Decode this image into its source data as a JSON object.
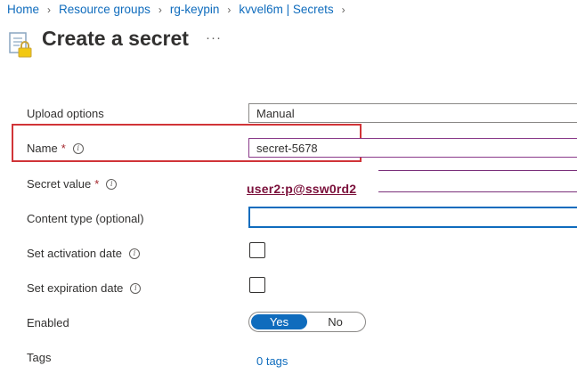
{
  "breadcrumb": [
    {
      "label": "Home"
    },
    {
      "label": "Resource groups"
    },
    {
      "label": "rg-keypin"
    },
    {
      "label": "kvvel6m | Secrets"
    }
  ],
  "header": {
    "title": "Create a secret",
    "more": "···"
  },
  "form": {
    "upload_options": {
      "label": "Upload options",
      "value": "Manual"
    },
    "name": {
      "label": "Name",
      "required": "*",
      "value": "secret-5678"
    },
    "secret_value": {
      "label": "Secret value",
      "required": "*",
      "value": "user2:p@ssw0rd2"
    },
    "content_type": {
      "label": "Content type (optional)",
      "value": ""
    },
    "activation": {
      "label": "Set activation date",
      "checked": false
    },
    "expiration": {
      "label": "Set expiration date",
      "checked": false
    },
    "enabled": {
      "label": "Enabled",
      "yes": "Yes",
      "no": "No",
      "selected": "Yes"
    },
    "tags": {
      "label": "Tags",
      "link": "0 tags"
    }
  },
  "info_glyph": "i",
  "colors": {
    "accent": "#0f6cbd",
    "highlight": "#d13438",
    "secret_text": "#7a0f3a"
  }
}
